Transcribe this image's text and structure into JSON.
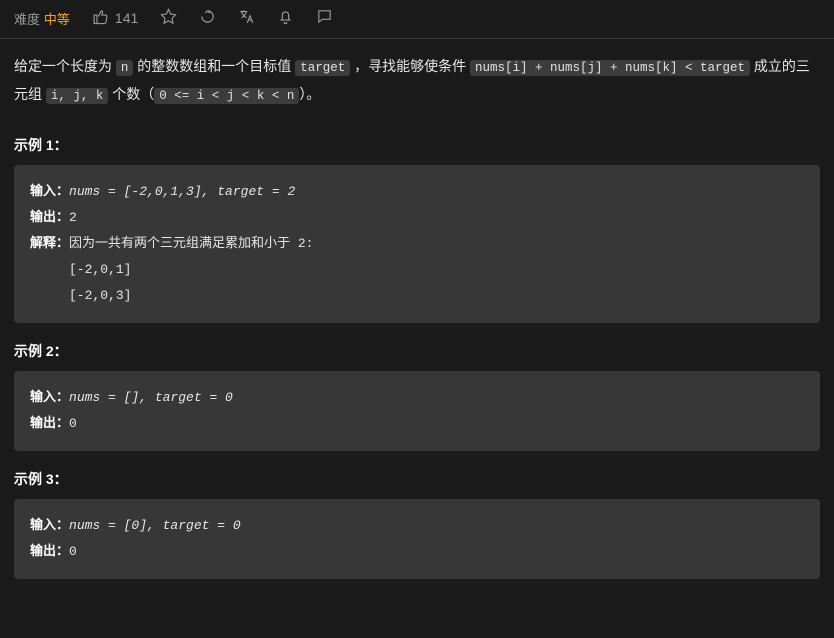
{
  "topbar": {
    "difficulty_label": "难度",
    "difficulty_value": "中等",
    "likes": "141"
  },
  "description": {
    "t1": "给定一个长度为 ",
    "c1": "n",
    "t2": " 的整数数组和一个目标值 ",
    "c2": "target",
    "t3": " ，寻找能够使条件 ",
    "c3": "nums[i] + nums[j] + nums[k] < target",
    "t4": " 成立的三元组 ",
    "c4": "i, j, k",
    "t5": " 个数（",
    "c5": "0 <= i < j < k < n",
    "t6": "）。"
  },
  "examples": [
    {
      "title": "示例 1：",
      "input_label": "输入：",
      "input_value": "nums = [-2,0,1,3], target = 2",
      "output_label": "输出：",
      "output_value": "2",
      "explain_label": "解释：",
      "explain_text": "因为一共有两个三元组满足累加和小于 2:",
      "extra1": "     [-2,0,1]",
      "extra2": "     [-2,0,3]"
    },
    {
      "title": "示例 2：",
      "input_label": "输入：",
      "input_value": "nums = [], target = 0",
      "output_label": "输出：",
      "output_value": "0"
    },
    {
      "title": "示例 3：",
      "input_label": "输入：",
      "input_value": "nums = [0], target = 0",
      "output_label": "输出：",
      "output_value": "0"
    }
  ]
}
